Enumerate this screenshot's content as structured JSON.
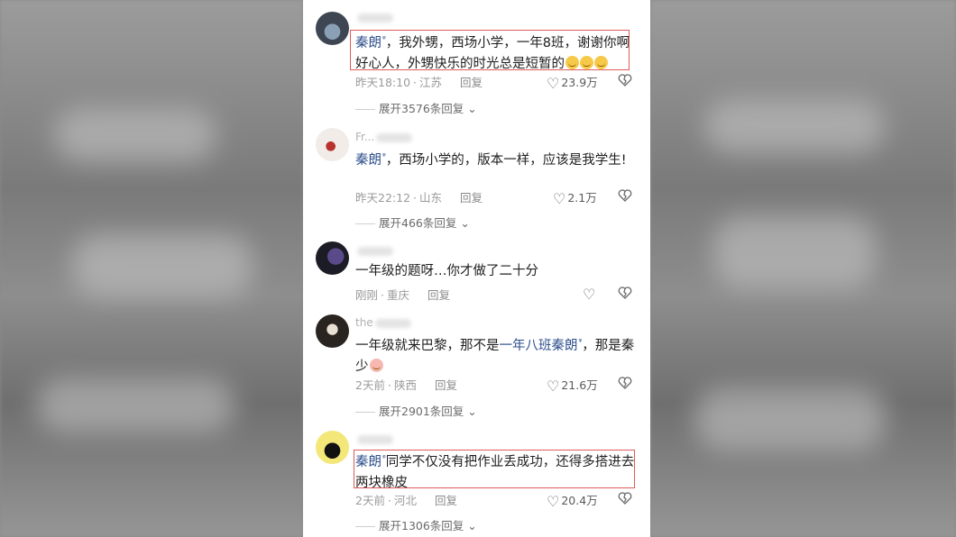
{
  "comments": [
    {
      "username": "",
      "mention": "秦朗",
      "text": "，我外甥，西场小学，一年8班，谢谢你啊好心人，外甥快乐的时光总是短暂的",
      "time": "昨天18:10",
      "location": "江苏",
      "reply": "回复",
      "likes": "23.9万",
      "expand": "展开3576条回复",
      "emoji_icon": "grin-emoji"
    },
    {
      "username": "Fr...",
      "mention": "秦朗",
      "text": "，西场小学的，版本一样，应该是我学生!",
      "time": "昨天22:12",
      "location": "山东",
      "reply": "回复",
      "likes": "2.1万",
      "expand": "展开466条回复"
    },
    {
      "username": "",
      "text": "一年级的题呀…你才做了二十分",
      "time": "刚刚",
      "location": "重庆",
      "reply": "回复",
      "likes": ""
    },
    {
      "username": "the",
      "text_before": "一年级就来巴黎，那不是",
      "mention": "一年八班秦朗",
      "text_after": "，那是秦少",
      "time": "2天前",
      "location": "陕西",
      "reply": "回复",
      "likes": "21.6万",
      "expand": "展开2901条回复",
      "emoji_icon": "cry-emoji"
    },
    {
      "username": "",
      "mention": "秦朗",
      "text": "同学不仅没有把作业丢成功，还得多搭进去两块橡皮",
      "time": "2天前",
      "location": "河北",
      "reply": "回复",
      "likes": "20.4万",
      "expand": "展开1306条回复"
    }
  ],
  "colors": {
    "mention": "#2d4f8c",
    "highlight_box": "#e05a5a"
  }
}
